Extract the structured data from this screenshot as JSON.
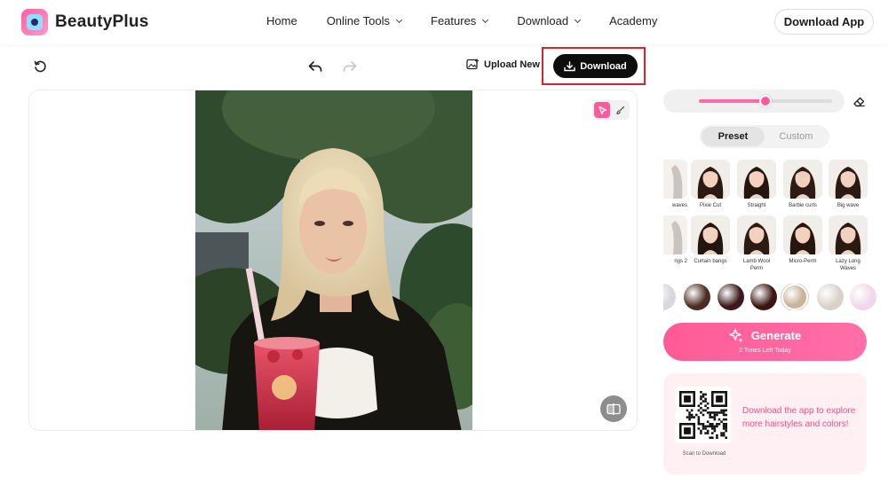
{
  "brand": {
    "name": "BeautyPlus"
  },
  "nav": {
    "items": [
      {
        "label": "Home",
        "dropdown": false
      },
      {
        "label": "Online Tools",
        "dropdown": true
      },
      {
        "label": "Features",
        "dropdown": true
      },
      {
        "label": "Download",
        "dropdown": true
      },
      {
        "label": "Academy",
        "dropdown": false
      }
    ],
    "download_app": "Download App"
  },
  "toolbar": {
    "upload_new": "Upload New",
    "download": "Download"
  },
  "brush": {
    "level": 0.5
  },
  "tabs": {
    "preset": "Preset",
    "custom": "Custom",
    "active": "preset"
  },
  "hairstyles": [
    {
      "label": "waves"
    },
    {
      "label": "Pixie Cut"
    },
    {
      "label": "Straight"
    },
    {
      "label": "Barbie curls"
    },
    {
      "label": "Big wave"
    },
    {
      "label": "ngs 2"
    },
    {
      "label": "Curtain bangs"
    },
    {
      "label": "Lamb Wool Perm"
    },
    {
      "label": "Micro-Perm"
    },
    {
      "label": "Lazy Long Waves"
    }
  ],
  "hair_colors": [
    "#d8d8dc",
    "#4a2e22",
    "#3a1a1c",
    "#3d1612",
    "#c9b49a",
    "#d7d2c9",
    "#f0d8e8"
  ],
  "selected_color": 4,
  "generate": {
    "label": "Generate",
    "remaining": "2 Times Left Today"
  },
  "promo": {
    "text": "Download the app to explore more hairstyles and colors!",
    "qr_caption": "Scan to Download"
  },
  "colors": {
    "accent": "#ff5b9b",
    "highlight": "#d9222a"
  }
}
